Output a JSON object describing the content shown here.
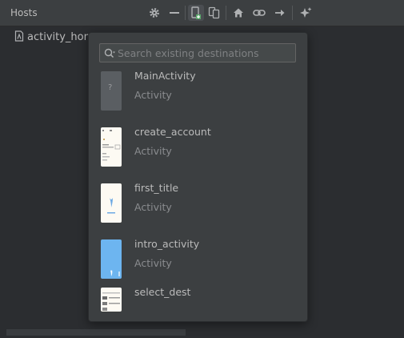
{
  "panel": {
    "title": "Hosts"
  },
  "toolbar": {
    "icons": [
      "gear-icon",
      "minimize-icon",
      "new-destination-icon",
      "nested-graph-icon",
      "home-icon",
      "link-icon",
      "arrow-right-icon",
      "auto-arrange-icon"
    ],
    "active_icon": "new-destination-icon",
    "active_icon_color": "#59a869"
  },
  "hosts": {
    "items": [
      {
        "label": "activity_hom",
        "icon": "layout-file-icon"
      }
    ]
  },
  "popup": {
    "search": {
      "placeholder": "Search existing destinations",
      "value": ""
    },
    "destinations": [
      {
        "name": "MainActivity",
        "type": "Activity",
        "preview": "placeholder-preview",
        "placeholder_glyph": "?"
      },
      {
        "name": "create_account",
        "type": "Activity",
        "preview": "form-layout-preview"
      },
      {
        "name": "first_title",
        "type": "Activity",
        "preview": "title-layout-preview"
      },
      {
        "name": "intro_activity",
        "type": "Activity",
        "preview": "blue-layout-preview",
        "preview_color": "#6db5f0"
      },
      {
        "name": "select_dest",
        "type": "",
        "preview": "list-layout-preview"
      }
    ]
  }
}
